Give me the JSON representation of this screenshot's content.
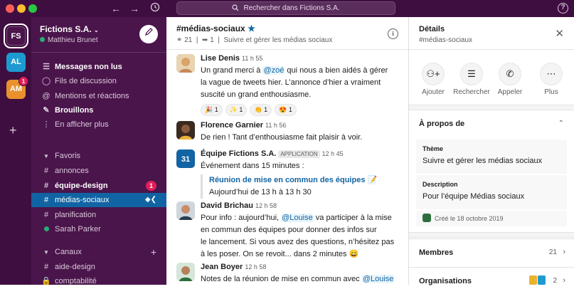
{
  "titlebar": {
    "search_placeholder": "Rechercher dans Fictions S.A.",
    "help": "?"
  },
  "rail": {
    "workspaces": [
      {
        "label": "FS",
        "color": "#4a154b"
      },
      {
        "label": "AL",
        "color": "#1d9bd1"
      },
      {
        "label": "AM",
        "color": "#e8912d",
        "badge": "1"
      }
    ]
  },
  "sidebar": {
    "workspace_name": "Fictions S.A.",
    "user_name": "Matthieu Brunet",
    "nav": [
      {
        "label": "Messages non lus",
        "bold": true
      },
      {
        "label": "Fils de discussion"
      },
      {
        "label": "Mentions et réactions"
      },
      {
        "label": "Brouillons",
        "bold": true
      },
      {
        "label": "En afficher plus"
      }
    ],
    "favorites_title": "Favoris",
    "favorites": [
      {
        "label": "annonces"
      },
      {
        "label": "équipe-design",
        "bold": true,
        "badge": "1"
      },
      {
        "label": "médias-sociaux",
        "selected": true
      },
      {
        "label": "planification"
      },
      {
        "label": "Sarah Parker",
        "dm": true
      }
    ],
    "channels_title": "Canaux",
    "channels": [
      {
        "label": "aide-design"
      },
      {
        "label": "comptabilité",
        "locked": true
      }
    ]
  },
  "channel": {
    "name": "#médias-sociaux",
    "members": "21",
    "pins": "1",
    "topic": "Suivre et gérer les médias sociaux",
    "messages": [
      {
        "author": "Lise Denis",
        "time": "11 h 55",
        "lines": [
          "Un grand merci à @zoé qui nous a bien aidés à gérer",
          "la vague de tweets hier. L’annonce d’hier a vraiment",
          "suscité un grand enthousiasme."
        ],
        "mention": "@zoé",
        "reactions": [
          "🎉 1",
          "✨ 1",
          "👏 1",
          "😍 1"
        ]
      },
      {
        "author": "Florence Garnier",
        "time": "11 h 56",
        "lines": [
          "De rien ! Tant d’enthousiasme fait plaisir à voir."
        ]
      },
      {
        "author": "Équipe Fictions S.A.",
        "tag": "APPLICATION",
        "time": "12 h 45",
        "lines": [
          "Événement dans 15 minutes :"
        ],
        "event_title": "Réunion de mise en commun des équipes",
        "event_time": "Aujourd’hui de 13 h à 13 h 30",
        "calendar_day": "31"
      },
      {
        "author": "David Brichau",
        "time": "12 h 58",
        "lines": [
          "Pour info : aujourd’hui, @Louise va participer à la mise",
          "en commun des équipes pour donner des infos sur",
          "le lancement. Si vous avez des questions, n’hésitez pas",
          "à les poser. On se revoit... dans 2 minutes 😄"
        ],
        "mention": "@Louise"
      },
      {
        "author": "Jean Boyer",
        "time": "12 h 58",
        "lines": [
          "Notes de la réunion de mise en commun avec @Louise"
        ],
        "mention": "@Louise"
      }
    ]
  },
  "details": {
    "title": "Détails",
    "subtitle": "#médias-sociaux",
    "actions": [
      "Ajouter",
      "Rechercher",
      "Appeler",
      "Plus"
    ],
    "about_title": "À propos de",
    "theme_label": "Thème",
    "theme_value": "Suivre et gérer les médias sociaux",
    "desc_label": "Description",
    "desc_value": "Pour l’équipe Médias sociaux",
    "created": "Créé le 18 octobre 2019",
    "members_label": "Membres",
    "members_count": "21",
    "orgs_label": "Organisations",
    "orgs_count": "2"
  }
}
